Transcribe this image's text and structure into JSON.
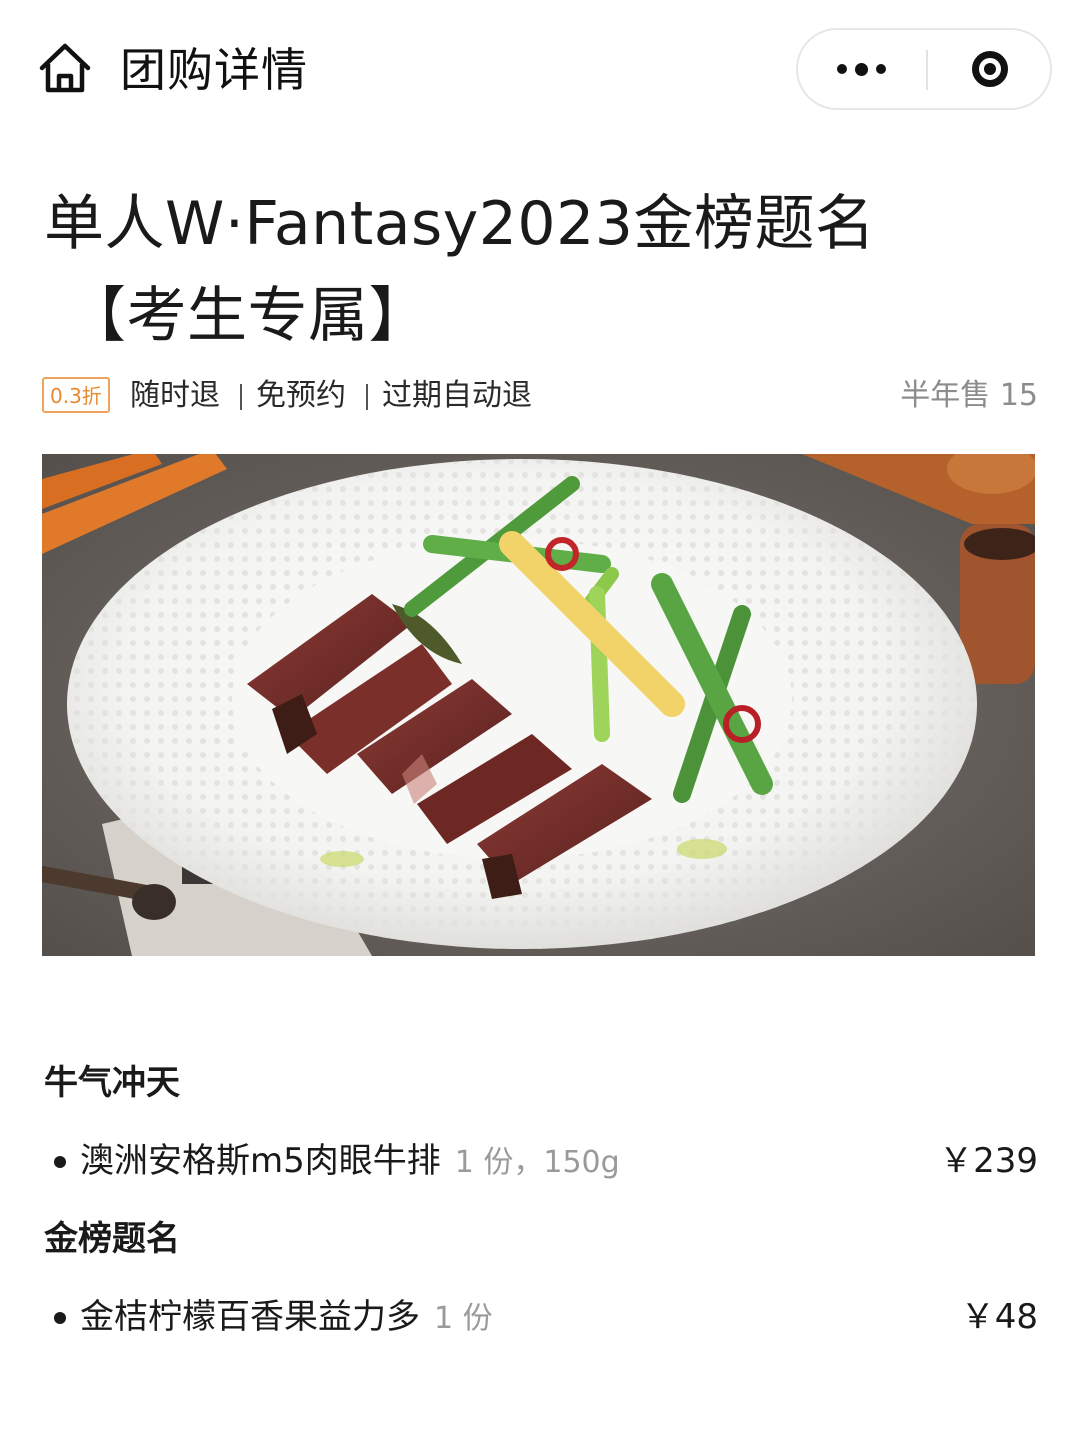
{
  "nav": {
    "title": "团购详情"
  },
  "deal": {
    "title_line1": "单人W·Fantasy2023金榜题名",
    "title_line2": "【考生专属】",
    "discount_badge": "0.3折",
    "features": [
      "随时退",
      "免预约",
      "过期自动退"
    ],
    "sold": "半年售 15"
  },
  "menu": {
    "sections": [
      {
        "name": "牛气冲天",
        "items": [
          {
            "name": "澳洲安格斯m5肉眼牛排",
            "meta": "1 份，150g",
            "price": "￥239"
          }
        ]
      },
      {
        "name": "金榜题名",
        "items": [
          {
            "name": "金桔柠檬百香果益力多",
            "meta": "1 份",
            "price": "￥48"
          }
        ]
      }
    ]
  },
  "colors": {
    "discount_border": "#f0a35c",
    "discount_text": "#e88a2e",
    "muted_text": "#8c8c8c"
  }
}
